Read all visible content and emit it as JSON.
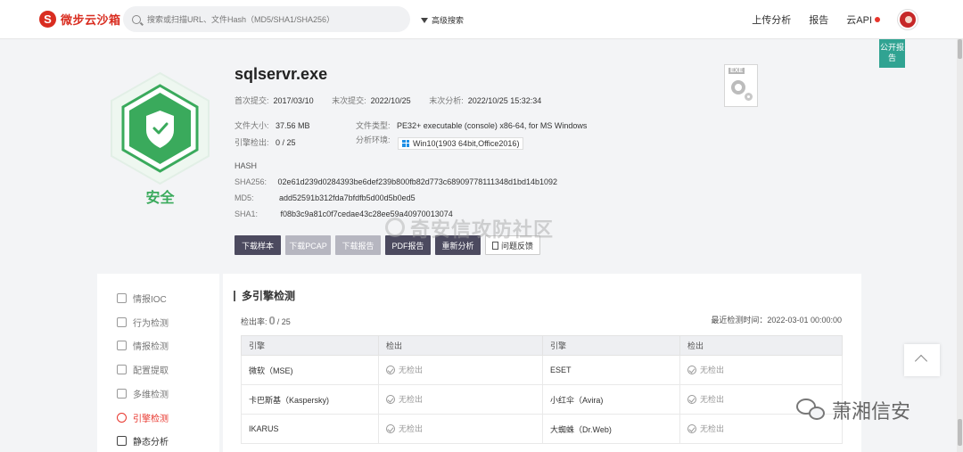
{
  "nav": {
    "logo_text": "微步云沙箱",
    "search_placeholder": "搜索或扫描URL、文件Hash（MD5/SHA1/SHA256）",
    "advanced_search": "高级搜索",
    "links": [
      "上传分析",
      "报告",
      "云API"
    ]
  },
  "public_badge": "公开报告",
  "verdict": {
    "label": "安全",
    "color": "#3aaa5c"
  },
  "file": {
    "name": "sqlservr.exe",
    "first_submit_label": "首次提交:",
    "first_submit": "2017/03/10",
    "last_submit_label": "末次提交:",
    "last_submit": "2022/10/25",
    "last_analysis_label": "末次分析:",
    "last_analysis": "2022/10/25 15:32:34",
    "size_label": "文件大小:",
    "size": "37.56 MB",
    "type_label": "文件类型:",
    "type": "PE32+ executable (console) x86-64, for MS Windows",
    "engine_label": "引擎检出:",
    "engine": "0 / 25",
    "env_label": "分析环境:",
    "env": "Win10(1903 64bit,Office2016)",
    "hash_heading": "HASH",
    "sha256_label": "SHA256:",
    "sha256": "02e61d239d0284393be6def239b800fb82d773c68909778111348d1bd14b1092",
    "md5_label": "MD5:",
    "md5": "add52591b312fda7bfdfb5d00d5b0ed5",
    "sha1_label": "SHA1:",
    "sha1": "f08b3c9a81c0f7cedae43c28ee59a40970013074",
    "exe_tag": "EXE"
  },
  "actions": [
    "下载样本",
    "下载PCAP",
    "下载报告",
    "PDF报告",
    "重新分析",
    "问题反馈"
  ],
  "watermark": "奇安信攻防社区",
  "sidebar": [
    "情报IOC",
    "行为检测",
    "情报检测",
    "配置提取",
    "多维检测",
    "引擎检测",
    "静态分析"
  ],
  "engines": {
    "title": "多引擎检测",
    "rate_label": "检出率:",
    "rate_num": "0",
    "rate_total": "/ 25",
    "last_check": "最近检测时间：2022-03-01 00:00:00",
    "headers": [
      "引擎",
      "检出",
      "引擎",
      "检出"
    ],
    "no_detect": "无检出",
    "rows": [
      [
        "微软（MSE)",
        "ESET"
      ],
      [
        "卡巴斯基（Kaspersky)",
        "小红伞（Avira)"
      ],
      [
        "IKARUS",
        "大蜘蛛（Dr.Web)"
      ]
    ]
  },
  "brand_watermark": "萧湘信安"
}
